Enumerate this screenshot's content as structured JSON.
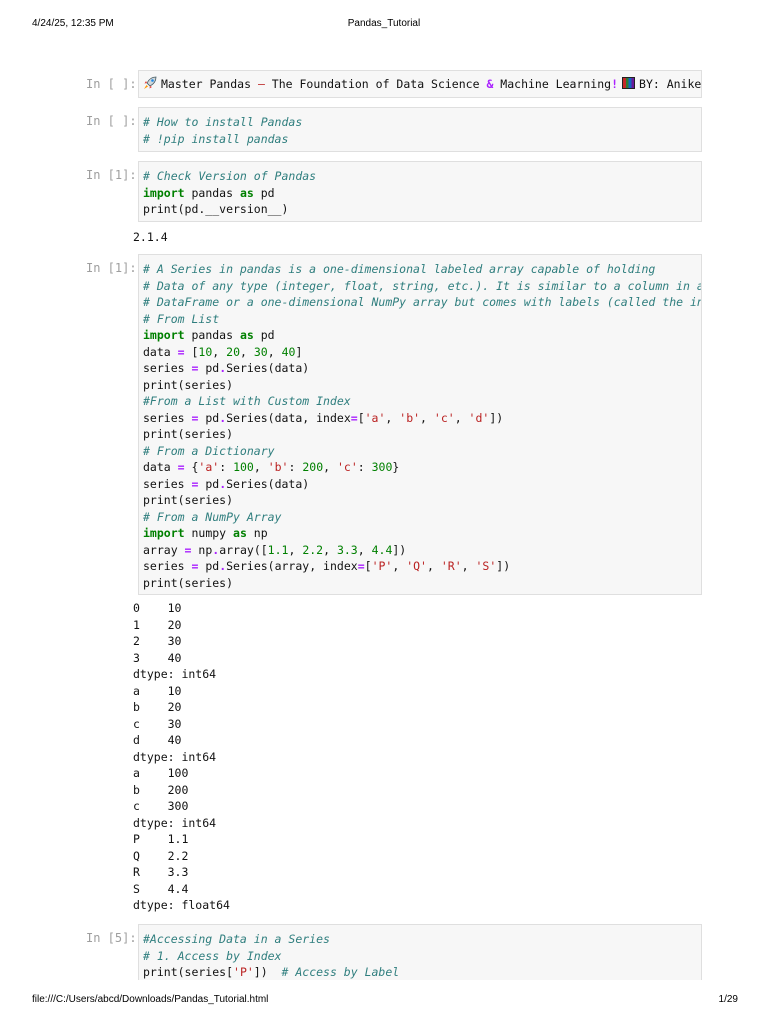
{
  "page_header": {
    "datetime": "4/24/25, 12:35 PM",
    "title": "Pandas_Tutorial"
  },
  "page_footer": {
    "path": "file:///C:/Users/abcd/Downloads/Pandas_Tutorial.html",
    "page": "1/29"
  },
  "cells": [
    {
      "prompt": "In [ ]:",
      "lines": [
        [
          [
            "rocket",
            ""
          ],
          [
            "p",
            "Master Pandas "
          ],
          [
            "x",
            "–"
          ],
          [
            "p",
            " The Foundation of Data Science "
          ],
          [
            "a",
            "&"
          ],
          [
            "p",
            " Machine Learning"
          ],
          [
            "a",
            "!"
          ],
          [
            "bars",
            ""
          ],
          [
            "p",
            "BY: Aniket"
          ]
        ]
      ]
    },
    {
      "prompt": "In [ ]:",
      "lines": [
        [
          [
            "c",
            "# How to install Pandas"
          ]
        ],
        [
          [
            "c",
            "# !pip install pandas"
          ]
        ]
      ]
    },
    {
      "prompt": "In [1]:",
      "lines": [
        [
          [
            "c",
            "# Check Version of Pandas"
          ]
        ],
        [
          [
            "k",
            "import"
          ],
          [
            "p",
            " pandas "
          ],
          [
            "k",
            "as"
          ],
          [
            "p",
            " pd"
          ]
        ],
        [
          [
            "p",
            "print(pd.__version__)"
          ]
        ]
      ],
      "output": [
        "2.1.4"
      ]
    },
    {
      "prompt": "In [1]:",
      "lines": [
        [
          [
            "c",
            "# A Series in pandas is a one-dimensional labeled array capable of holding"
          ]
        ],
        [
          [
            "c",
            "# Data of any type (integer, float, string, etc.). It is similar to a column in a"
          ]
        ],
        [
          [
            "c",
            "# DataFrame or a one-dimensional NumPy array but comes with labels (called the index"
          ]
        ],
        [
          [
            "c",
            "# From List"
          ]
        ],
        [
          [
            "k",
            "import"
          ],
          [
            "p",
            " pandas "
          ],
          [
            "k",
            "as"
          ],
          [
            "p",
            " pd"
          ]
        ],
        [
          [
            "p",
            "data "
          ],
          [
            "o",
            "="
          ],
          [
            "p",
            " ["
          ],
          [
            "n",
            "10"
          ],
          [
            "p",
            ", "
          ],
          [
            "n",
            "20"
          ],
          [
            "p",
            ", "
          ],
          [
            "n",
            "30"
          ],
          [
            "p",
            ", "
          ],
          [
            "n",
            "40"
          ],
          [
            "p",
            "]"
          ]
        ],
        [
          [
            "p",
            "series "
          ],
          [
            "o",
            "="
          ],
          [
            "p",
            " pd"
          ],
          [
            "o",
            "."
          ],
          [
            "p",
            "Series(data)"
          ]
        ],
        [
          [
            "p",
            "print(series)"
          ]
        ],
        [
          [
            "c",
            "#From a List with Custom Index"
          ]
        ],
        [
          [
            "p",
            "series "
          ],
          [
            "o",
            "="
          ],
          [
            "p",
            " pd"
          ],
          [
            "o",
            "."
          ],
          [
            "p",
            "Series(data, index"
          ],
          [
            "o",
            "="
          ],
          [
            "p",
            "["
          ],
          [
            "s",
            "'a'"
          ],
          [
            "p",
            ", "
          ],
          [
            "s",
            "'b'"
          ],
          [
            "p",
            ", "
          ],
          [
            "s",
            "'c'"
          ],
          [
            "p",
            ", "
          ],
          [
            "s",
            "'d'"
          ],
          [
            "p",
            "])"
          ]
        ],
        [
          [
            "p",
            "print(series)"
          ]
        ],
        [
          [
            "c",
            "# From a Dictionary"
          ]
        ],
        [
          [
            "p",
            "data "
          ],
          [
            "o",
            "="
          ],
          [
            "p",
            " {"
          ],
          [
            "s",
            "'a'"
          ],
          [
            "p",
            ": "
          ],
          [
            "n",
            "100"
          ],
          [
            "p",
            ", "
          ],
          [
            "s",
            "'b'"
          ],
          [
            "p",
            ": "
          ],
          [
            "n",
            "200"
          ],
          [
            "p",
            ", "
          ],
          [
            "s",
            "'c'"
          ],
          [
            "p",
            ": "
          ],
          [
            "n",
            "300"
          ],
          [
            "p",
            "}"
          ]
        ],
        [
          [
            "p",
            "series "
          ],
          [
            "o",
            "="
          ],
          [
            "p",
            " pd"
          ],
          [
            "o",
            "."
          ],
          [
            "p",
            "Series(data)"
          ]
        ],
        [
          [
            "p",
            "print(series)"
          ]
        ],
        [
          [
            "c",
            "# From a NumPy Array"
          ]
        ],
        [
          [
            "k",
            "import"
          ],
          [
            "p",
            " numpy "
          ],
          [
            "k",
            "as"
          ],
          [
            "p",
            " np"
          ]
        ],
        [
          [
            "p",
            "array "
          ],
          [
            "o",
            "="
          ],
          [
            "p",
            " np"
          ],
          [
            "o",
            "."
          ],
          [
            "p",
            "array(["
          ],
          [
            "n",
            "1.1"
          ],
          [
            "p",
            ", "
          ],
          [
            "n",
            "2.2"
          ],
          [
            "p",
            ", "
          ],
          [
            "n",
            "3.3"
          ],
          [
            "p",
            ", "
          ],
          [
            "n",
            "4.4"
          ],
          [
            "p",
            "])"
          ]
        ],
        [
          [
            "p",
            "series "
          ],
          [
            "o",
            "="
          ],
          [
            "p",
            " pd"
          ],
          [
            "o",
            "."
          ],
          [
            "p",
            "Series(array, index"
          ],
          [
            "o",
            "="
          ],
          [
            "p",
            "["
          ],
          [
            "s",
            "'P'"
          ],
          [
            "p",
            ", "
          ],
          [
            "s",
            "'Q'"
          ],
          [
            "p",
            ", "
          ],
          [
            "s",
            "'R'"
          ],
          [
            "p",
            ", "
          ],
          [
            "s",
            "'S'"
          ],
          [
            "p",
            "])"
          ]
        ],
        [
          [
            "p",
            "print(series)"
          ]
        ]
      ],
      "output": [
        "0    10",
        "1    20",
        "2    30",
        "3    40",
        "dtype: int64",
        "a    10",
        "b    20",
        "c    30",
        "d    40",
        "dtype: int64",
        "a    100",
        "b    200",
        "c    300",
        "dtype: int64",
        "P    1.1",
        "Q    2.2",
        "R    3.3",
        "S    4.4",
        "dtype: float64"
      ]
    },
    {
      "prompt": "In [5]:",
      "lines": [
        [
          [
            "c",
            "#Accessing Data in a Series"
          ]
        ],
        [
          [
            "c",
            "# 1. Access by Index"
          ]
        ],
        [
          [
            "p",
            "print(series["
          ],
          [
            "s",
            "'P'"
          ],
          [
            "p",
            "])  "
          ],
          [
            "c",
            "# Access by Label"
          ]
        ]
      ]
    }
  ]
}
